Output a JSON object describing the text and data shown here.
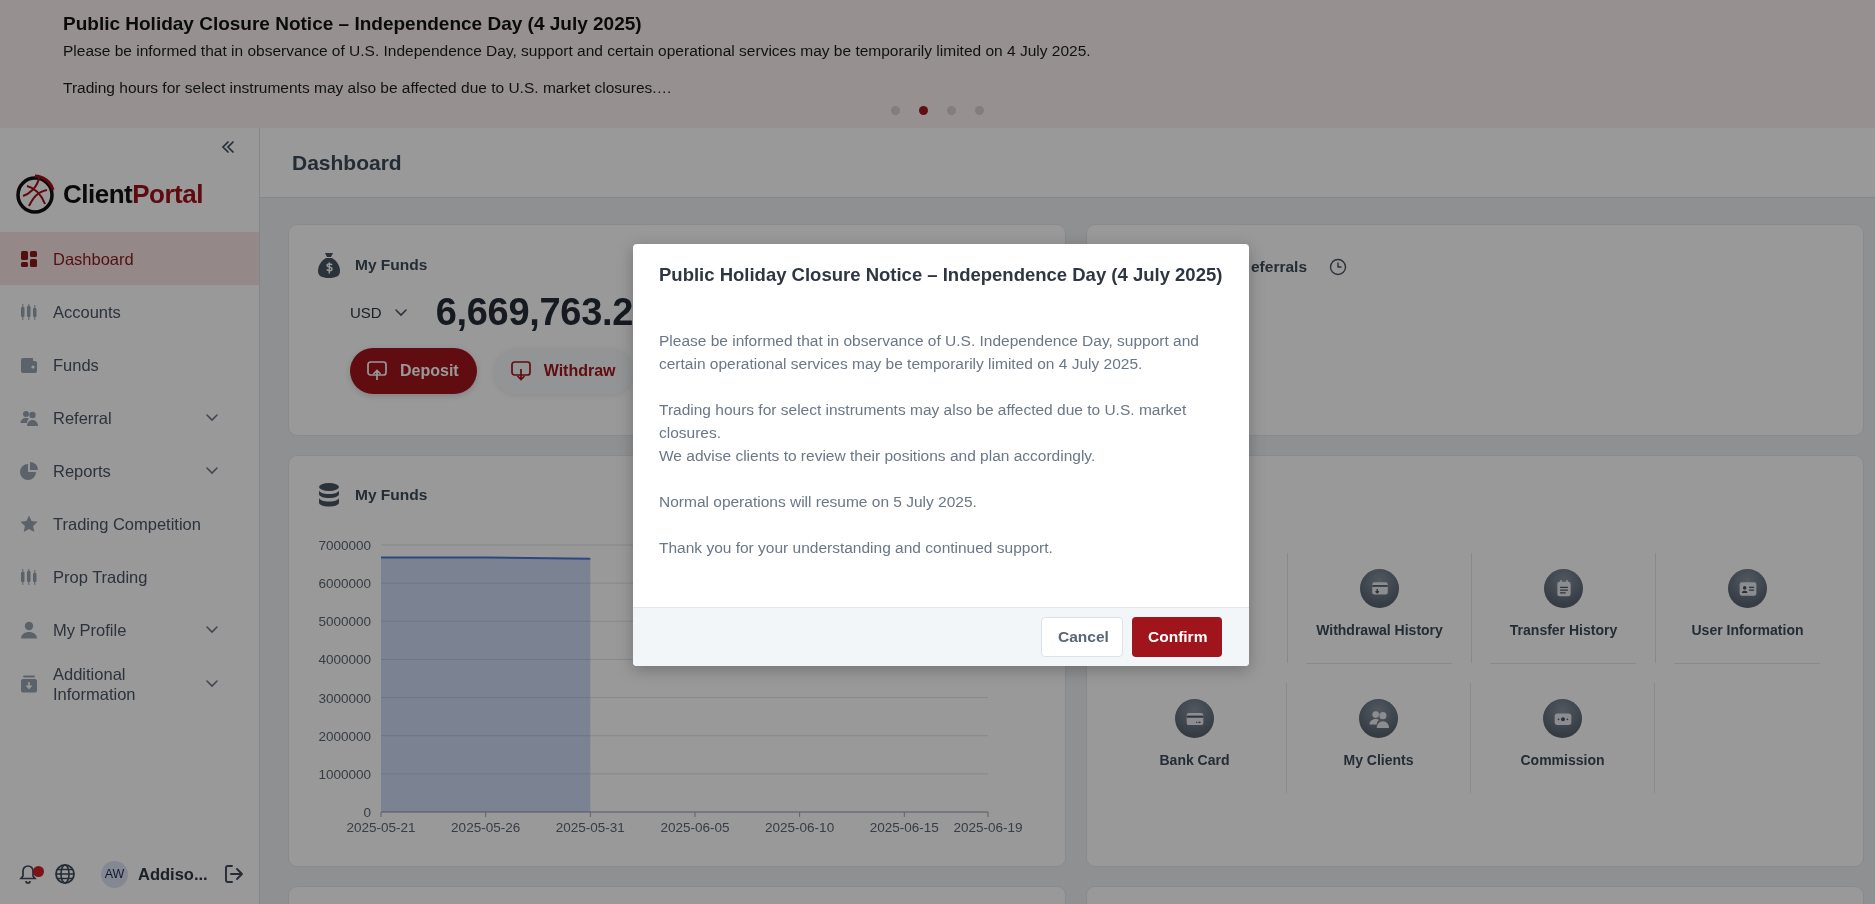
{
  "banner": {
    "title": "Public Holiday Closure Notice – Independence Day (4 July 2025)",
    "lines": [
      "Please be informed that in observance of U.S. Independence Day, support and certain operational services may be temporarily limited on 4 July 2025.",
      "Trading hours for select instruments may also be affected due to U.S. market closures.…"
    ],
    "dots": [
      {
        "selected": false
      },
      {
        "selected": true
      },
      {
        "selected": false
      },
      {
        "selected": false
      }
    ]
  },
  "sidebar": {
    "logo": {
      "first": "Client",
      "second": "Portal"
    },
    "items": [
      {
        "label": "Dashboard",
        "kind": "dashboard",
        "selected": true,
        "has_submenu": false
      },
      {
        "label": "Accounts",
        "kind": "candles",
        "selected": false,
        "has_submenu": false
      },
      {
        "label": "Funds",
        "kind": "wallet",
        "selected": false,
        "has_submenu": false
      },
      {
        "label": "Referral",
        "kind": "users",
        "selected": false,
        "has_submenu": true
      },
      {
        "label": "Reports",
        "kind": "pie",
        "selected": false,
        "has_submenu": true
      },
      {
        "label": "Trading Competition",
        "kind": "star",
        "selected": false,
        "has_submenu": false
      },
      {
        "label": "Prop Trading",
        "kind": "candles",
        "selected": false,
        "has_submenu": false
      },
      {
        "label": "My Profile",
        "kind": "user",
        "selected": false,
        "has_submenu": true
      },
      {
        "label": "Additional Information",
        "kind": "archive",
        "selected": false,
        "has_submenu": true
      }
    ],
    "footer": {
      "has_unread": true,
      "avatar": "AW",
      "user": "Addiso..."
    }
  },
  "page_title": "Dashboard",
  "funds_card": {
    "title": "My Funds",
    "currency": "USD",
    "amount": "6,669,763.2",
    "buttons": [
      {
        "label": "Deposit",
        "kind": "primary"
      },
      {
        "label": "Withdraw",
        "kind": "secondary"
      }
    ]
  },
  "referrals_card": {
    "title": "eferrals"
  },
  "chart_card": {
    "title": "My Funds",
    "chart_data": {
      "type": "area",
      "grid": true,
      "x": [
        "2025-05-21",
        "2025-05-26",
        "2025-05-31",
        "2025-06-05",
        "2025-06-10",
        "2025-06-15",
        "2025-06-19"
      ],
      "series": [
        {
          "color": "#4a78d6",
          "values": [
            6670000,
            6670000,
            6640000,
            null,
            null,
            null,
            null
          ]
        }
      ],
      "ylim": [
        0,
        7000000
      ],
      "yticks": [
        0,
        1000000,
        2000000,
        3000000,
        4000000,
        5000000,
        6000000,
        7000000
      ]
    }
  },
  "shortcuts": [
    {
      "label": "Withdrawal History",
      "kind": "withdraw"
    },
    {
      "label": "Transfer History",
      "kind": "transfer"
    },
    {
      "label": "User Information",
      "kind": "idcard"
    },
    {
      "label": "Bank Card",
      "kind": "card"
    },
    {
      "label": "My Clients",
      "kind": "users"
    },
    {
      "label": "Commission",
      "kind": "money"
    }
  ],
  "modal": {
    "title": "Public Holiday Closure Notice – Independence Day (4 July 2025)",
    "paragraphs": [
      {
        "lines": [
          "Please be informed that in observance of U.S. Independence Day, support and",
          "certain operational services may be temporarily limited on 4 July 2025."
        ]
      },
      {
        "lines": [
          "Trading hours for select instruments may also be affected due to U.S. market",
          "closures.",
          "We advise clients to review their positions and plan accordingly."
        ]
      },
      {
        "lines": [
          "Normal operations will resume on 5 July 2025."
        ]
      },
      {
        "lines": [
          "Thank you for your understanding and continued support."
        ]
      }
    ],
    "buttons": [
      {
        "label": "Cancel",
        "kind": "secondary"
      },
      {
        "label": "Confirm",
        "kind": "primary"
      }
    ]
  }
}
